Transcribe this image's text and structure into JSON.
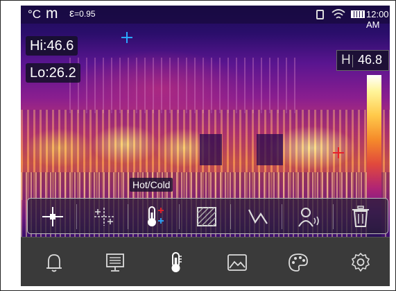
{
  "status": {
    "unit": "°C",
    "mode": "m",
    "emissivity_label": "ε",
    "emissivity_value": "=0.95",
    "time": "12:00 AM",
    "icons": [
      "sd-card-icon",
      "wifi-icon",
      "battery-icon"
    ]
  },
  "readouts": {
    "hi": "Hi:46.6",
    "lo": "Lo:26.2"
  },
  "scale": {
    "label": "H",
    "value": "46.8"
  },
  "tooltip": "Hot/Cold",
  "toolbar": {
    "items": [
      {
        "name": "center-point-icon"
      },
      {
        "name": "multi-point-icon"
      },
      {
        "name": "hot-cold-icon"
      },
      {
        "name": "area-icon"
      },
      {
        "name": "line-icon"
      },
      {
        "name": "voice-icon"
      },
      {
        "name": "delete-icon"
      }
    ],
    "selected": "hot-cold-icon"
  },
  "bottom_nav": {
    "items": [
      {
        "name": "alarm-bell-icon"
      },
      {
        "name": "display-icon"
      },
      {
        "name": "thermometer-icon"
      },
      {
        "name": "image-icon"
      },
      {
        "name": "palette-icon"
      },
      {
        "name": "settings-gear-icon"
      }
    ]
  },
  "colors": {
    "cursor_hot": "#e8202a",
    "cursor_cold": "#2aa8ff",
    "cursor_center": "#ffffff"
  }
}
